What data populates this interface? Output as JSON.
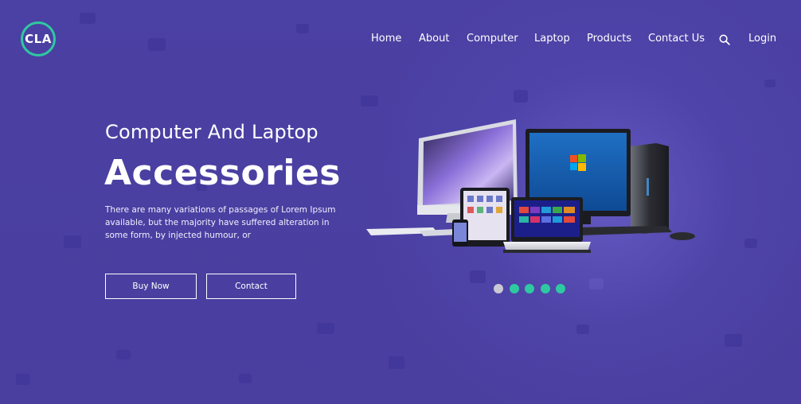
{
  "brand": {
    "logo_text": "CLA"
  },
  "nav": {
    "items": [
      {
        "label": "Home"
      },
      {
        "label": "About"
      },
      {
        "label": "Computer"
      },
      {
        "label": "Laptop"
      },
      {
        "label": "Products"
      },
      {
        "label": "Contact Us"
      }
    ],
    "search_icon": "search-icon",
    "login_label": "Login"
  },
  "hero": {
    "subtitle": "Computer And Laptop",
    "title": "Accessories",
    "description": "There are many variations of passages of Lorem Ipsum available, but the majority have suffered alteration in some form, by injected humour, or",
    "buy_label": "Buy Now",
    "contact_label": "Contact"
  },
  "slider": {
    "count": 5,
    "active_index": 0,
    "active_color": "#c9c9d6",
    "inactive_color": "#2ec9a0"
  },
  "colors": {
    "background": "#4a3fa0",
    "accent": "#2ec9a0",
    "text": "#ffffff"
  }
}
